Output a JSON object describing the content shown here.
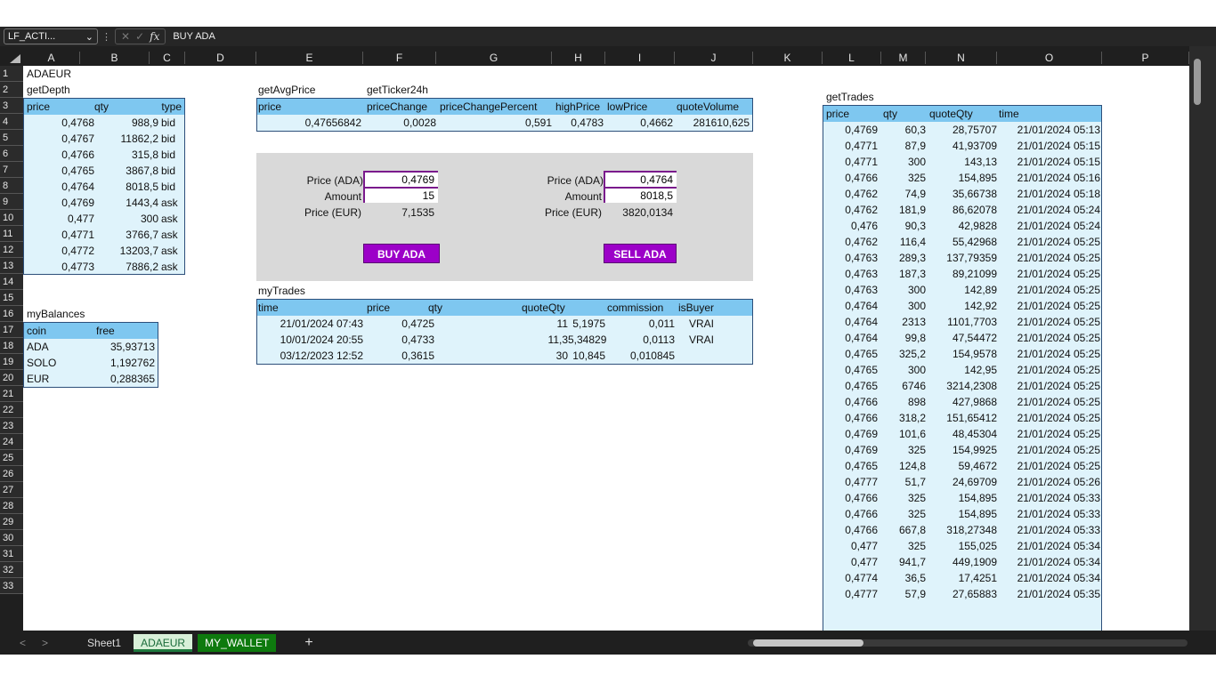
{
  "formula_bar": {
    "name_box": "LF_ACTI...",
    "value": "BUY ADA",
    "fx": "fx"
  },
  "columns": [
    "A",
    "B",
    "C",
    "D",
    "E",
    "F",
    "G",
    "H",
    "I",
    "J",
    "K",
    "L",
    "M",
    "N",
    "O",
    "P"
  ],
  "rows": [
    "1",
    "2",
    "3",
    "4",
    "5",
    "6",
    "7",
    "8",
    "9",
    "10",
    "11",
    "12",
    "13",
    "14",
    "15",
    "16",
    "17",
    "18",
    "19",
    "20",
    "21",
    "22",
    "23",
    "24",
    "25",
    "26",
    "27",
    "28",
    "29",
    "30",
    "31",
    "32",
    "33"
  ],
  "a1": "ADAEUR",
  "a2": "getDepth",
  "depth": {
    "headers": [
      "price",
      "qty",
      "type"
    ],
    "rows": [
      [
        "0,4768",
        "988,9",
        "bid"
      ],
      [
        "0,4767",
        "11862,2",
        "bid"
      ],
      [
        "0,4766",
        "315,8",
        "bid"
      ],
      [
        "0,4765",
        "3867,8",
        "bid"
      ],
      [
        "0,4764",
        "8018,5",
        "bid"
      ],
      [
        "0,4769",
        "1443,4",
        "ask"
      ],
      [
        "0,477",
        "300",
        "ask"
      ],
      [
        "0,4771",
        "3766,7",
        "ask"
      ],
      [
        "0,4772",
        "13203,7",
        "ask"
      ],
      [
        "0,4773",
        "7886,2",
        "ask"
      ]
    ]
  },
  "balances": {
    "title": "myBalances",
    "headers": [
      "coin",
      "free"
    ],
    "rows": [
      [
        "ADA",
        "35,93713"
      ],
      [
        "SOLO",
        "1,192762"
      ],
      [
        "EUR",
        "0,288365"
      ]
    ]
  },
  "avg": {
    "title": "getAvgPrice",
    "header": "price",
    "value": "0,47656842"
  },
  "ticker": {
    "title": "getTicker24h",
    "headers": [
      "priceChange",
      "priceChangePercent",
      "highPrice",
      "lowPrice",
      "quoteVolume"
    ],
    "values": [
      "0,0028",
      "0,591",
      "0,4783",
      "0,4662",
      "281610,625"
    ]
  },
  "buy": {
    "price_label": "Price (ADA)",
    "price": "0,4769",
    "amount_label": "Amount",
    "amount": "15",
    "eur_label": "Price (EUR)",
    "eur": "7,1535",
    "button": "BUY ADA"
  },
  "sell": {
    "price_label": "Price (ADA)",
    "price": "0,4764",
    "amount_label": "Amount",
    "amount": "8018,5",
    "eur_label": "Price (EUR)",
    "eur": "3820,0134",
    "button": "SELL ADA"
  },
  "mytrades": {
    "title": "myTrades",
    "headers": [
      "time",
      "price",
      "qty",
      "quoteQty",
      "commission",
      "isBuyer"
    ],
    "rows": [
      [
        "21/01/2024 07:43",
        "0,4725",
        "11",
        "5,1975",
        "0,011",
        "VRAI"
      ],
      [
        "10/01/2024 20:55",
        "0,4733",
        "11,3",
        "5,34829",
        "0,0113",
        "VRAI"
      ],
      [
        "03/12/2023 12:52",
        "0,3615",
        "30",
        "10,845",
        "0,010845",
        ""
      ]
    ]
  },
  "trades": {
    "title": "getTrades",
    "headers": [
      "price",
      "qty",
      "quoteQty",
      "time"
    ],
    "rows": [
      [
        "0,4769",
        "60,3",
        "28,75707",
        "21/01/2024 05:13"
      ],
      [
        "0,4771",
        "87,9",
        "41,93709",
        "21/01/2024 05:15"
      ],
      [
        "0,4771",
        "300",
        "143,13",
        "21/01/2024 05:15"
      ],
      [
        "0,4766",
        "325",
        "154,895",
        "21/01/2024 05:16"
      ],
      [
        "0,4762",
        "74,9",
        "35,66738",
        "21/01/2024 05:18"
      ],
      [
        "0,4762",
        "181,9",
        "86,62078",
        "21/01/2024 05:24"
      ],
      [
        "0,476",
        "90,3",
        "42,9828",
        "21/01/2024 05:24"
      ],
      [
        "0,4762",
        "116,4",
        "55,42968",
        "21/01/2024 05:25"
      ],
      [
        "0,4763",
        "289,3",
        "137,79359",
        "21/01/2024 05:25"
      ],
      [
        "0,4763",
        "187,3",
        "89,21099",
        "21/01/2024 05:25"
      ],
      [
        "0,4763",
        "300",
        "142,89",
        "21/01/2024 05:25"
      ],
      [
        "0,4764",
        "300",
        "142,92",
        "21/01/2024 05:25"
      ],
      [
        "0,4764",
        "2313",
        "1101,7703",
        "21/01/2024 05:25"
      ],
      [
        "0,4764",
        "99,8",
        "47,54472",
        "21/01/2024 05:25"
      ],
      [
        "0,4765",
        "325,2",
        "154,9578",
        "21/01/2024 05:25"
      ],
      [
        "0,4765",
        "300",
        "142,95",
        "21/01/2024 05:25"
      ],
      [
        "0,4765",
        "6746",
        "3214,2308",
        "21/01/2024 05:25"
      ],
      [
        "0,4766",
        "898",
        "427,9868",
        "21/01/2024 05:25"
      ],
      [
        "0,4766",
        "318,2",
        "151,65412",
        "21/01/2024 05:25"
      ],
      [
        "0,4769",
        "101,6",
        "48,45304",
        "21/01/2024 05:25"
      ],
      [
        "0,4769",
        "325",
        "154,9925",
        "21/01/2024 05:25"
      ],
      [
        "0,4765",
        "124,8",
        "59,4672",
        "21/01/2024 05:25"
      ],
      [
        "0,4777",
        "51,7",
        "24,69709",
        "21/01/2024 05:26"
      ],
      [
        "0,4766",
        "325",
        "154,895",
        "21/01/2024 05:33"
      ],
      [
        "0,4766",
        "325",
        "154,895",
        "21/01/2024 05:33"
      ],
      [
        "0,4766",
        "667,8",
        "318,27348",
        "21/01/2024 05:33"
      ],
      [
        "0,477",
        "325",
        "155,025",
        "21/01/2024 05:34"
      ],
      [
        "0,477",
        "941,7",
        "449,1909",
        "21/01/2024 05:34"
      ],
      [
        "0,4774",
        "36,5",
        "17,4251",
        "21/01/2024 05:34"
      ],
      [
        "0,4777",
        "57,9",
        "27,65883",
        "21/01/2024 05:35"
      ]
    ]
  },
  "tabs": [
    "Sheet1",
    "ADAEUR",
    "MY_WALLET"
  ],
  "add_tab": "+",
  "colors": {
    "header_blue": "#7ec7f0",
    "cell_blue": "#dff3fb",
    "button_purple": "#9c00c8"
  }
}
